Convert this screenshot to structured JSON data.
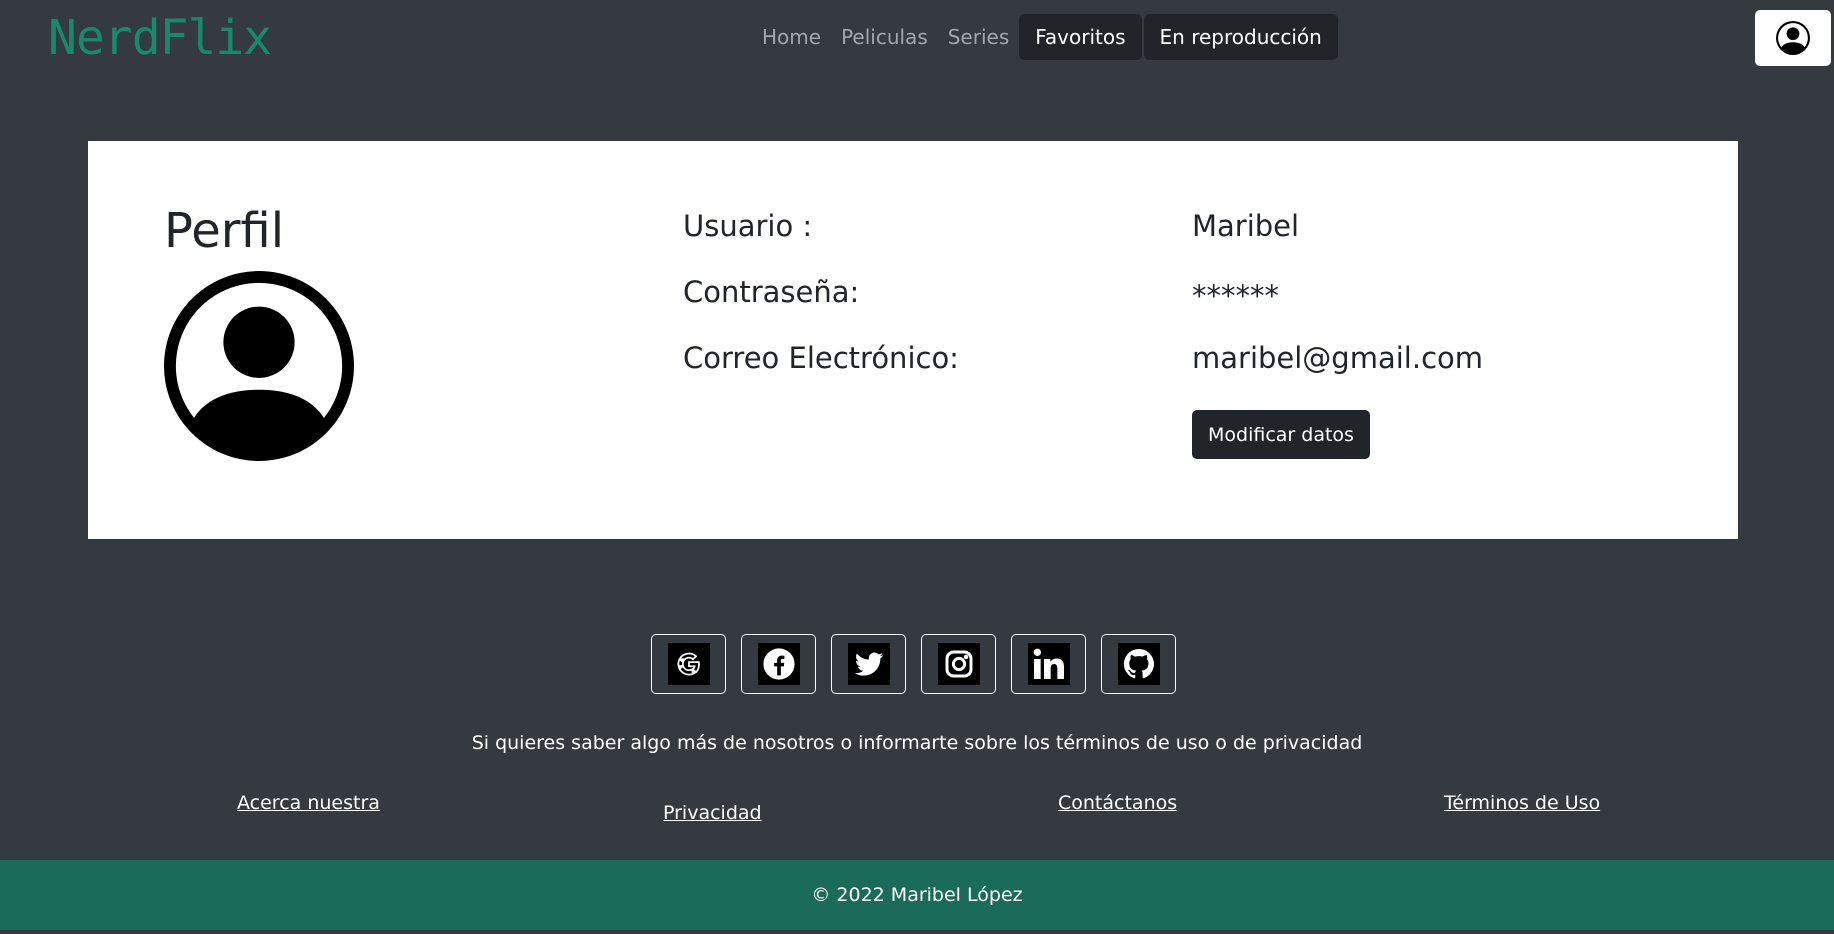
{
  "navbar": {
    "brand": "NerdFlix",
    "links": [
      "Home",
      "Peliculas",
      "Series"
    ],
    "buttons": [
      "Favoritos",
      "En reproducción"
    ],
    "user_icon": "person-circle-icon"
  },
  "profile": {
    "title": "Perfil",
    "avatar_icon": "person-circle-icon",
    "labels": {
      "user": "Usuario :",
      "password": "Contraseña:",
      "email": "Correo Electrónico:"
    },
    "values": {
      "user": "Maribel",
      "password": "******",
      "email": "maribel@gmail.com"
    },
    "modify_button": "Modificar datos"
  },
  "footer": {
    "social_icons": [
      "google-icon",
      "facebook-icon",
      "twitter-icon",
      "instagram-icon",
      "linkedin-icon",
      "github-icon"
    ],
    "text": "Si quieres saber algo más de nosotros o informarte sobre los términos de uso o de privacidad",
    "links": {
      "about": "Acerca nuestra",
      "privacy": "Privacidad",
      "contact": "Contáctanos",
      "terms": "Términos de Uso"
    },
    "copyright": "© 2022 Maribel López"
  },
  "colors": {
    "background": "#343a40",
    "brand": "#168a6c",
    "footer_bar": "#1a6b5a",
    "dark_button": "#212529"
  }
}
